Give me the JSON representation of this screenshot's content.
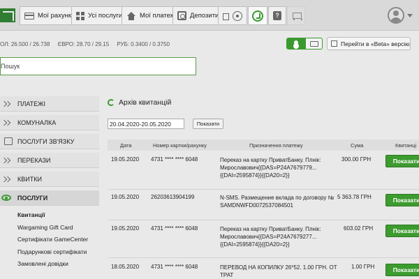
{
  "nav": {
    "tabs": [
      {
        "label": "Мої рахунки",
        "icon": "card-icon"
      },
      {
        "label": "Усі послуги",
        "icon": "grid-icon"
      },
      {
        "label": "Мої платежі",
        "icon": "house-icon"
      },
      {
        "label": "Депозити",
        "icon": "safe-icon"
      }
    ],
    "help_symbol": "?"
  },
  "rates": {
    "usd": "ОЛ: 26.500 / 26.738",
    "eur_label": "ЄВРО:",
    "eur": "28.70 / 29.15",
    "rub_label": "РУБ:",
    "rub": "0.3400 / 0.3750"
  },
  "beta_button": "Перейти в «Beta» версію",
  "search": {
    "placeholder": "Пошук",
    "value": ""
  },
  "sidebar": {
    "items": [
      {
        "label": "ПЛАТЕЖІ",
        "icon": "chevron-icon"
      },
      {
        "label": "КОМУНАЛКА",
        "icon": "chevron-icon"
      },
      {
        "label": "ПОСЛУГИ ЗВ'ЯЗКУ",
        "icon": "phone-icon"
      },
      {
        "label": "ПЕРЕКАЗИ",
        "icon": "chevron-icon"
      },
      {
        "label": "КВИТКИ",
        "icon": "chevron-icon"
      },
      {
        "label": "ПОСЛУГИ",
        "icon": "eye-icon"
      }
    ],
    "sub_items": [
      "Квитанції",
      "Wargaming Gift Card",
      "Сертифікати GameCenter",
      "Подарункові сертифікати",
      "Замовлені довідки"
    ]
  },
  "main": {
    "title": "Архів квитанцій",
    "date_range": "20.04.2020-20.05.2020",
    "show_small_label": "Показати",
    "columns": {
      "date": "Дата",
      "card": "Номер картки/рахунку",
      "purpose": "Призначення платежу",
      "amount": "Сума",
      "receipt": "Квитанці"
    },
    "rows": [
      {
        "date": "19.05.2020",
        "card": "4731 **** **** 6048",
        "purpose": "Переказ на картку ПриватБанку. Плнік: Мирославович{{DAS=P24A7679779...{{DAI=2595874}}{{DA20=2}}",
        "amount": "300.00 ГРН",
        "button": "Показати"
      },
      {
        "date": "19.05.2020",
        "card": "26203613904199",
        "purpose": "N-SMS. Размещение вклада по договору № SAMDNWFD0072537084501",
        "amount": "5 363.78 ГРН",
        "button": "Показати"
      },
      {
        "date": "19.05.2020",
        "card": "4731 **** **** 6048",
        "purpose": "Переказ на картку ПриватБанку. Плнік: Мирославович{{DAS=P24A7679277...{{DAI=2595874}}{{DA20=2}}",
        "amount": "603.02 ГРН",
        "button": "Показати"
      },
      {
        "date": "18.05.2020",
        "card": "4731 **** **** 6048",
        "purpose": "ПЕРЕВОД НА КОПИЛКУ 26*52. 1.00 ГРН. ОТ ТРАТ",
        "amount": "1.00 ГРН",
        "button": "Показати"
      }
    ]
  },
  "colors": {
    "accent": "#3d9b2f",
    "topbar": "#d9d9d9",
    "background": "#e9e9e9"
  }
}
